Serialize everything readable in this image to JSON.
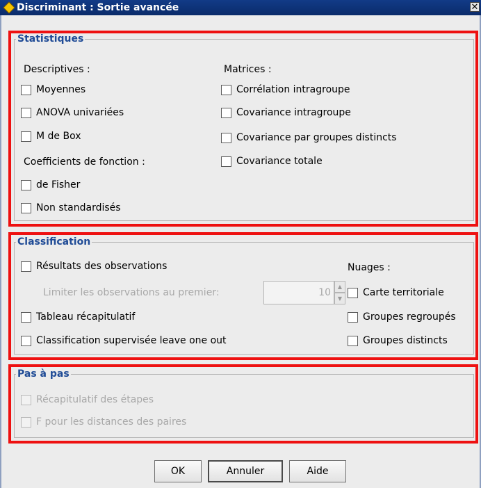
{
  "window": {
    "title": "Discriminant : Sortie avancée",
    "close_glyph": "✕",
    "icon": "diamond-icon"
  },
  "statistiques": {
    "title": "Statistiques",
    "descriptives_label": "Descriptives :",
    "matrices_label": "Matrices :",
    "coefficients_label": "Coefficients de fonction :",
    "items": {
      "moyennes": "Moyennes",
      "anova": "ANOVA univariées",
      "m_de_box": "M de Box",
      "de_fisher": "de Fisher",
      "non_standardises": "Non standardisés",
      "correlation_intragroupe": "Corrélation intragroupe",
      "covariance_intragroupe": "Covariance intragroupe",
      "covariance_groupes_distincts": "Covariance par groupes distincts",
      "covariance_totale": "Covariance totale"
    }
  },
  "classification": {
    "title": "Classification",
    "nuages_label": "Nuages :",
    "items": {
      "resultats_observations": "Résultats des observations",
      "limiter_label": "Limiter les observations au premier:",
      "limiter_value": "10",
      "tableau_recapitulatif": "Tableau récapitulatif",
      "leave_one_out": "Classification supervisée leave one out",
      "carte_territoriale": "Carte territoriale",
      "groupes_regroupes": "Groupes regroupés",
      "groupes_distincts": "Groupes distincts"
    }
  },
  "pas_a_pas": {
    "title": "Pas à pas",
    "items": {
      "recapitulatif_etapes": "Récapitulatif des étapes",
      "f_distances_paires": "F pour les distances des paires"
    }
  },
  "buttons": {
    "ok": "OK",
    "annuler": "Annuler",
    "aide": "Aide"
  },
  "colors": {
    "highlight_box": "#ee1111",
    "group_title": "#1f4b96",
    "titlebar": "#123b87"
  }
}
